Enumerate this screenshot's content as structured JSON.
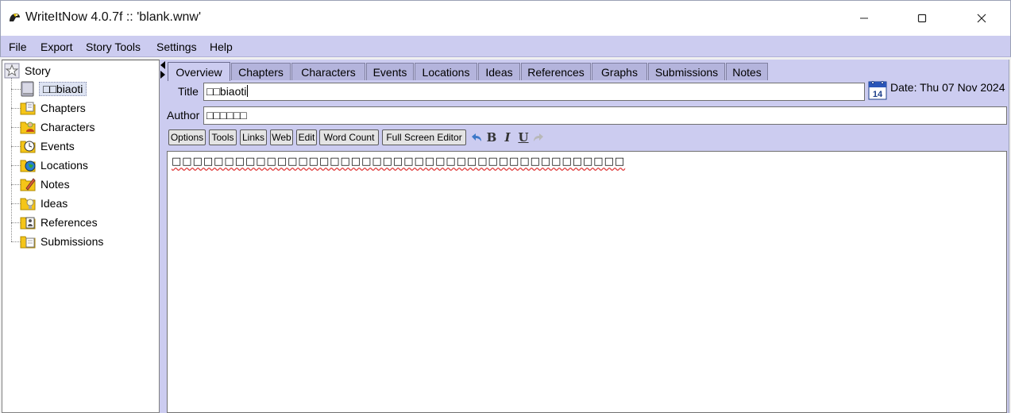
{
  "window": {
    "title": "WriteItNow 4.0.7f :: 'blank.wnw'",
    "icon": "app-bird-icon"
  },
  "menu": [
    "File",
    "Export",
    "Story Tools",
    "Settings",
    "Help"
  ],
  "tree": {
    "root": {
      "label": "Story",
      "icon": "star-book-icon"
    },
    "selected": {
      "label": "□□biaoti",
      "icon": "book-icon"
    },
    "items": [
      {
        "label": "Chapters",
        "icon": "chapters-folder-icon"
      },
      {
        "label": "Characters",
        "icon": "characters-folder-icon"
      },
      {
        "label": "Events",
        "icon": "events-folder-icon"
      },
      {
        "label": "Locations",
        "icon": "locations-folder-icon"
      },
      {
        "label": "Notes",
        "icon": "notes-folder-icon"
      },
      {
        "label": "Ideas",
        "icon": "ideas-folder-icon"
      },
      {
        "label": "References",
        "icon": "references-folder-icon"
      },
      {
        "label": "Submissions",
        "icon": "submissions-folder-icon"
      }
    ]
  },
  "tabs": [
    {
      "label": "Overview",
      "active": true
    },
    {
      "label": "Chapters"
    },
    {
      "label": "Characters"
    },
    {
      "label": "Events"
    },
    {
      "label": "Locations"
    },
    {
      "label": "Ideas"
    },
    {
      "label": "References"
    },
    {
      "label": "Graphs"
    },
    {
      "label": "Submissions"
    },
    {
      "label": "Notes"
    }
  ],
  "form": {
    "title_label": "Title",
    "title_value": "□□biaoti",
    "author_label": "Author",
    "author_value": "□□□□□□",
    "date_text": "Date: Thu 07 Nov 2024",
    "calendar_day": "14"
  },
  "toolbar": {
    "buttons": [
      "Options",
      "Tools",
      "Links",
      "Web",
      "Edit",
      "Word Count",
      "Full Screen Editor"
    ],
    "bold": "B",
    "italic": "I",
    "underline": "U"
  },
  "editor": {
    "content": "□□□□□□□□□□□□□□□□□□□□□□□□□□□□□□□□□□□□□□□□□□□"
  },
  "colors": {
    "menubar": "#ccccf0",
    "tab_inactive": "#b4b4dc",
    "spellcheck": "#e04040"
  }
}
